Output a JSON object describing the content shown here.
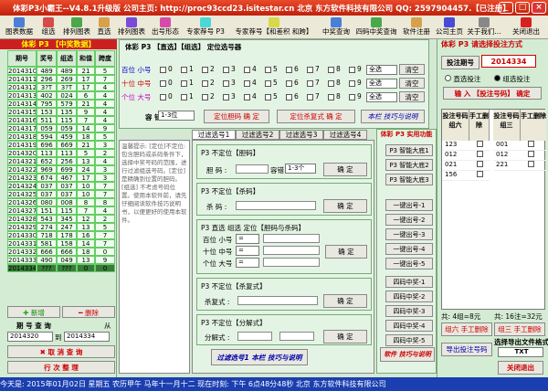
{
  "window": {
    "title": "体彩P3小霸王--V4.8.1升级版    公司主页: http://proc93ccd23.isitestar.cn    北京 东方软件科技有限公司    QQ: 2597904457.【已注册】",
    "min": "_",
    "max": "□",
    "close": "×"
  },
  "toolbar": [
    "图表数据",
    "组选",
    "排列图表",
    "直选",
    "排列图表",
    "出号形态",
    "专家荐号 P3",
    "专家荐号【和差积 和跨】",
    "中奖查询",
    "四码中奖查询",
    "软件注册",
    "公司主页",
    "关于我们...",
    "关闭退出"
  ],
  "left": {
    "title": "体彩 P3 【中奖数据】",
    "headers": [
      "期号",
      "奖号",
      "组选",
      "和值",
      "跨度"
    ],
    "rows": [
      [
        "2014310",
        "489",
        "489",
        "21",
        "5"
      ],
      [
        "2014311",
        "296",
        "269",
        "17",
        "7"
      ],
      [
        "2014312",
        "3?T",
        "3?T",
        "17",
        "4"
      ],
      [
        "2014313",
        "402",
        "024",
        "6",
        "4"
      ],
      [
        "2014314",
        "795",
        "579",
        "21",
        "4"
      ],
      [
        "2014315",
        "153",
        "135",
        "9",
        "4"
      ],
      [
        "2014316",
        "511",
        "115",
        "7",
        "4"
      ],
      [
        "2014317",
        "059",
        "059",
        "14",
        "9"
      ],
      [
        "2014318",
        "594",
        "459",
        "18",
        "5"
      ],
      [
        "2014319",
        "696",
        "669",
        "21",
        "3"
      ],
      [
        "2014320",
        "113",
        "113",
        "5",
        "2"
      ],
      [
        "2014321",
        "652",
        "256",
        "13",
        "4"
      ],
      [
        "2014322",
        "969",
        "699",
        "24",
        "3"
      ],
      [
        "2014323",
        "674",
        "467",
        "17",
        "3"
      ],
      [
        "2014324",
        "037",
        "037",
        "10",
        "7"
      ],
      [
        "2014325",
        "037",
        "037",
        "10",
        "7"
      ],
      [
        "2014326",
        "080",
        "008",
        "8",
        "8"
      ],
      [
        "2014327",
        "151",
        "115",
        "7",
        "4"
      ],
      [
        "2014328",
        "543",
        "345",
        "12",
        "2"
      ],
      [
        "2014329",
        "274",
        "247",
        "13",
        "5"
      ],
      [
        "2014330",
        "718",
        "178",
        "16",
        "7"
      ],
      [
        "2014331",
        "581",
        "158",
        "14",
        "7"
      ],
      [
        "2014332",
        "666",
        "666",
        "18",
        "0"
      ],
      [
        "2014333",
        "490",
        "049",
        "13",
        "9"
      ],
      [
        "2014334",
        "???",
        "???",
        "0",
        "0"
      ]
    ],
    "add": "新增",
    "del": "删除",
    "query_title": "期 号 查 询",
    "from": "从",
    "to": "到",
    "from_val": "2014320",
    "to_val": "2014334",
    "cancel": "取 消 查 询",
    "resort": "行 次 整 理"
  },
  "dingwei": {
    "title": "体彩 P3 【直选】【组选】 定位选号器",
    "rows": [
      {
        "label": "百位 小号"
      },
      {
        "label": "十位 中号"
      },
      {
        "label": "个位 大号"
      }
    ],
    "digits": [
      "0",
      "1",
      "2",
      "3",
      "4",
      "5",
      "6",
      "7",
      "8",
      "9"
    ],
    "sel": "全选",
    "clear": "清空",
    "capacity": "容 错",
    "cap_val": "1-3位",
    "btn1": "定位胆码 确 定",
    "btn2": "定位杀复式 确 定",
    "tips": "本栏 技巧与说明"
  },
  "tabs": [
    "过滤选号1",
    "过滤选号2",
    "过滤选号3",
    "过滤选号4"
  ],
  "filter": {
    "help": "温馨提示: [定位]不定位: 包含胆码或杀码条件下，选择中奖号码的范围，进行过滤组选号码。[定位] 是精确到位置的胆码。[组选] 不考虑号码位置。使用本软件前，请先仔细阅读软件技巧说明书，以便更好的使用本软件。",
    "g1": "P3 不定位【胆码】",
    "dan": "胆 码 :",
    "capacity": "容错",
    "cap_val": "1-3个",
    "ok": "确 定",
    "g2": "P3 不定位【杀码】",
    "sha": "杀 码 :",
    "g3": "P3 直选 组选 定位【胆码与杀码】",
    "r1": "百位 小号",
    "r2": "十位 中号",
    "r3": "个位 大号",
    "eq": "=",
    "g4": "P3 不定位【杀复式】",
    "shafu": "杀复式 :",
    "g5": "P3 不定位【分解式】",
    "fenjie": "分解式 :",
    "bottom": "过滤选号1 本栏 技巧与说明"
  },
  "mid": {
    "title": "体彩 P3 实用功能",
    "smart": [
      "P3 智能大底1",
      "P3 智能大底2",
      "P3 智能大底3"
    ],
    "one": [
      "一键出号-1",
      "一键出号-2",
      "一键出号-3",
      "一键出号-4",
      "一键出号-5"
    ],
    "four": [
      "四码中奖-1",
      "四码中奖-2",
      "四码中奖-3",
      "四码中奖-4",
      "四码中奖-5"
    ],
    "tips": "软件 技巧与说明"
  },
  "right": {
    "title": "体彩 P3 请选择投注方式",
    "period_label": "投注期号",
    "period": "2014334",
    "opt1": "直选投注",
    "opt2": "组选投注",
    "input_btn": "输 入 【投注号码】 确定",
    "col1": "投注号码组六",
    "col2": "手工删除",
    "col3": "投注号码组三",
    "col4": "手工删除",
    "list6": [
      "123",
      "012",
      "021",
      "156"
    ],
    "list3": [
      "001",
      "012",
      "221"
    ],
    "count1": "共: 4组=8元",
    "count2": "共: 16注=32元",
    "del1": "组六 手工删除",
    "del2": "组三 手工删除",
    "export_title": "选择导出文件格式",
    "fmt": "TXT",
    "export": "导出投注号码",
    "close": "关闭退出"
  },
  "status": "今天是: 2015年01月02日 星期五 农历甲午 马年十一月十二 现在时刻: 下午 6点48分48秒   北京 东方软件科技有限公司"
}
